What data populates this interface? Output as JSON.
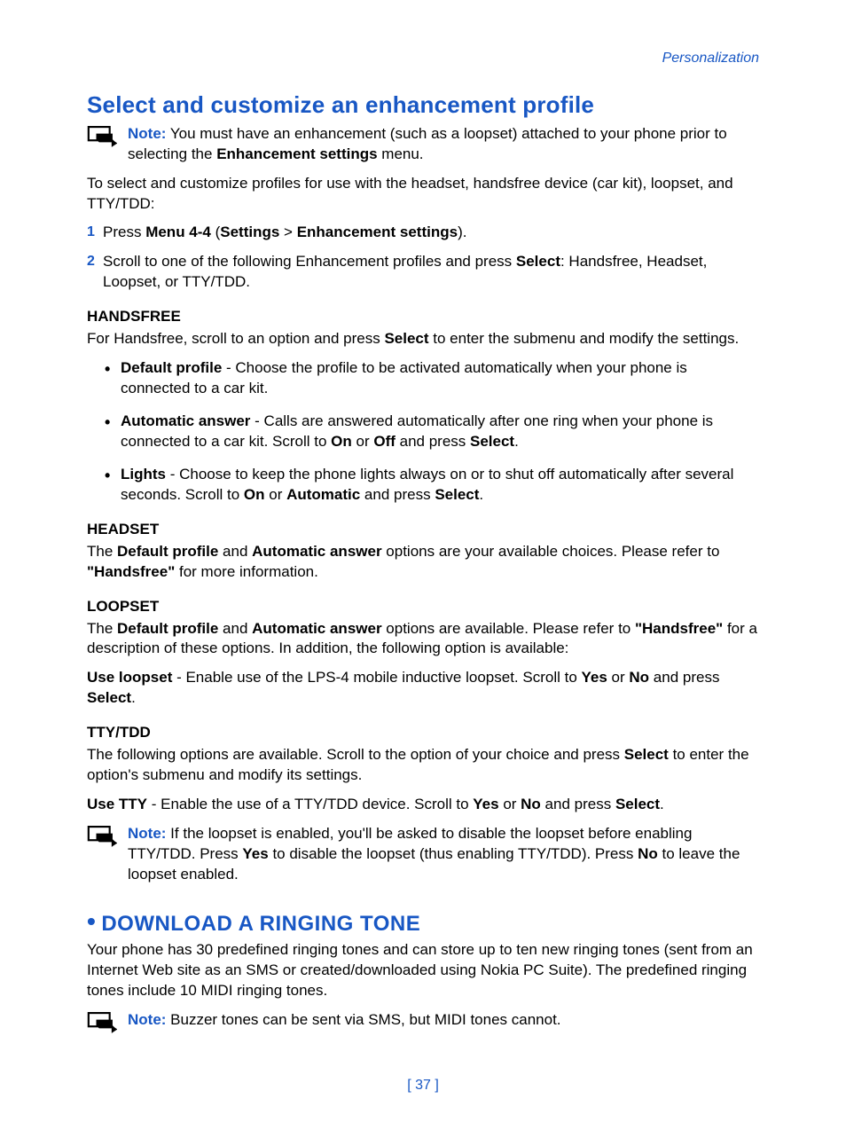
{
  "header": {
    "section": "Personalization"
  },
  "h1": "Select and customize an enhancement profile",
  "note1": {
    "label": "Note:",
    "text_a": " You must have an enhancement (such as a loopset) attached to your phone prior to selecting the ",
    "b1": "Enhancement settings",
    "text_b": " menu."
  },
  "intro": "To select and customize profiles for use with the headset, handsfree device (car kit), loopset, and TTY/TDD:",
  "steps": [
    {
      "n": "1",
      "a": "Press ",
      "b1": "Menu 4-4",
      "mid": " (",
      "b2": "Settings",
      "gt": " > ",
      "b3": "Enhancement settings",
      "end": ")."
    },
    {
      "n": "2",
      "a": "Scroll to one of the following Enhancement profiles and press ",
      "b1": "Select",
      "end": ": Handsfree, Headset, Loopset, or TTY/TDD."
    }
  ],
  "handsfree": {
    "title": "HANDSFREE",
    "intro_a": "For Handsfree, scroll to an option and press ",
    "intro_b": "Select",
    "intro_c": " to enter the submenu and modify the settings.",
    "items": [
      {
        "label": "Default profile",
        "text": " - Choose the profile to be activated automatically when your phone is connected to a car kit."
      },
      {
        "label": "Automatic answer",
        "text_a": " - Calls are answered automatically after one ring when your phone is connected to a car kit. Scroll to ",
        "b1": "On",
        "mid": " or ",
        "b2": "Off",
        "end_a": " and press ",
        "b3": "Select",
        "end_b": "."
      },
      {
        "label": "Lights",
        "text_a": " - Choose to keep the phone lights always on or to shut off automatically after several seconds. Scroll to ",
        "b1": "On",
        "mid": " or ",
        "b2": "Automatic",
        "end_a": " and press ",
        "b3": "Select",
        "end_b": "."
      }
    ]
  },
  "headset": {
    "title": "HEADSET",
    "a": "The ",
    "b1": "Default profile",
    "mid": " and ",
    "b2": "Automatic answer",
    "c": " options are your available choices. Please refer to ",
    "b3": "\"Handsfree\"",
    "d": " for more information."
  },
  "loopset": {
    "title": "LOOPSET",
    "p1_a": "The ",
    "p1_b1": "Default profile",
    "p1_mid": " and ",
    "p1_b2": "Automatic answer",
    "p1_c": " options are available. Please refer to ",
    "p1_b3": "\"Handsfree\"",
    "p1_d": " for a description of these options. In addition, the following option is available:",
    "p2_b1": "Use loopset",
    "p2_a": " - Enable use of the LPS-4 mobile inductive loopset. Scroll to ",
    "p2_b2": "Yes",
    "p2_mid": " or ",
    "p2_b3": "No",
    "p2_c": " and press ",
    "p2_b4": "Select",
    "p2_d": "."
  },
  "tty": {
    "title": "TTY/TDD",
    "p1_a": "The following options are available. Scroll to the option of your choice and press ",
    "p1_b1": "Select",
    "p1_b": " to enter the option's submenu and modify its settings.",
    "p2_b1": "Use TTY",
    "p2_a": " - Enable the use of a TTY/TDD device. Scroll to ",
    "p2_b2": "Yes",
    "p2_mid": " or ",
    "p2_b3": "No",
    "p2_c": " and press ",
    "p2_b4": "Select",
    "p2_d": "."
  },
  "note2": {
    "label": "Note:",
    "a": " If the loopset is enabled, you'll be asked to disable the loopset before enabling TTY/TDD. Press ",
    "b1": "Yes",
    "mid": " to disable the loopset (thus enabling TTY/TDD). Press ",
    "b2": "No",
    "end": " to leave the loopset enabled."
  },
  "download": {
    "title": "DOWNLOAD A RINGING TONE",
    "p": "Your phone has 30 predefined ringing tones and can store up to ten new ringing tones (sent from an Internet Web site as an SMS or created/downloaded using Nokia PC Suite). The predefined ringing tones include 10 MIDI ringing tones."
  },
  "note3": {
    "label": "Note:",
    "text": " Buzzer tones can be sent via SMS, but MIDI tones cannot."
  },
  "page": "[ 37 ]"
}
